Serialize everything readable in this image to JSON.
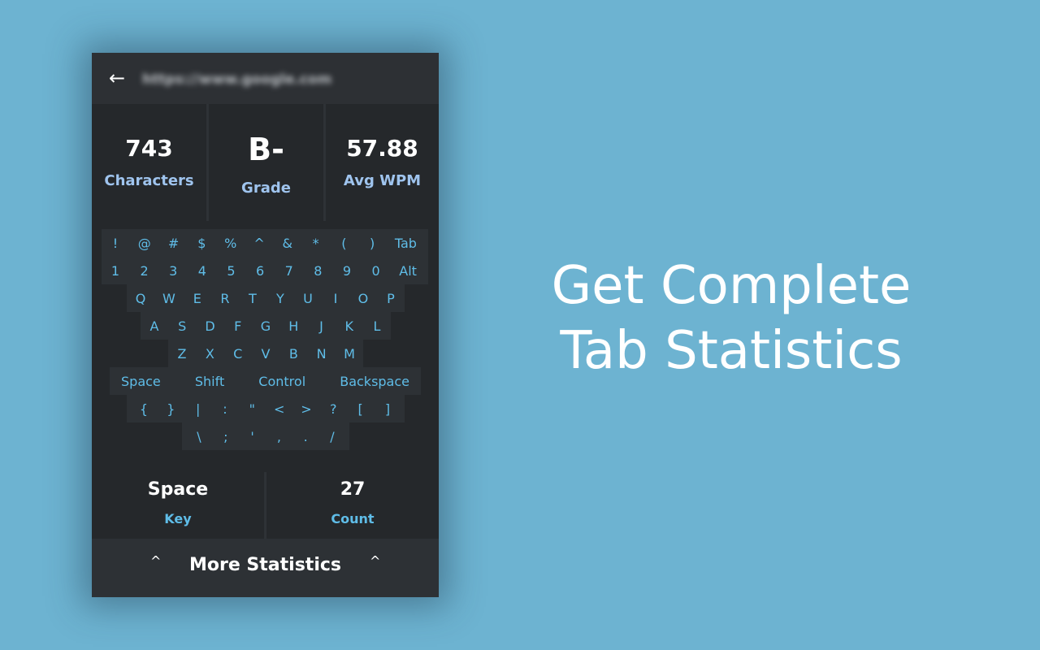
{
  "header": {
    "back_icon": "left-arrow-icon",
    "back_glyph": "←",
    "url": "https://www.google.com"
  },
  "stats_top": [
    {
      "value": "743",
      "label": "Characters"
    },
    {
      "value": "B-",
      "label": "Grade"
    },
    {
      "value": "57.88",
      "label": "Avg WPM"
    }
  ],
  "keyboard": {
    "rows": [
      [
        "!",
        "@",
        "#",
        "$",
        "%",
        "^",
        "&",
        "*",
        "(",
        ")",
        "Tab"
      ],
      [
        "1",
        "2",
        "3",
        "4",
        "5",
        "6",
        "7",
        "8",
        "9",
        "0",
        "Alt"
      ],
      [
        "Q",
        "W",
        "E",
        "R",
        "T",
        "Y",
        "U",
        "I",
        "O",
        "P"
      ],
      [
        "A",
        "S",
        "D",
        "F",
        "G",
        "H",
        "J",
        "K",
        "L"
      ],
      [
        "Z",
        "X",
        "C",
        "V",
        "B",
        "N",
        "M"
      ],
      [
        "Space",
        "Shift",
        "Control",
        "Backspace"
      ],
      [
        "{",
        "}",
        "|",
        ":",
        "\"",
        "<",
        ">",
        "?",
        "[",
        "]"
      ],
      [
        "\\",
        ";",
        "'",
        ",",
        ".",
        "/"
      ]
    ]
  },
  "stats_bottom": [
    {
      "value": "Space",
      "label": "Key"
    },
    {
      "value": "27",
      "label": "Count"
    }
  ],
  "more": {
    "label": "More Statistics",
    "caret_glyph": "^",
    "caret_icon": "caret-up-icon"
  },
  "headline": {
    "line1": "Get Complete",
    "line2": "Tab Statistics"
  },
  "colors": {
    "background": "#6db3d1",
    "panel": "#25282b",
    "key_text": "#5fbde8",
    "top_label": "#9fc4ee",
    "bottom_label": "#5fbde8"
  }
}
